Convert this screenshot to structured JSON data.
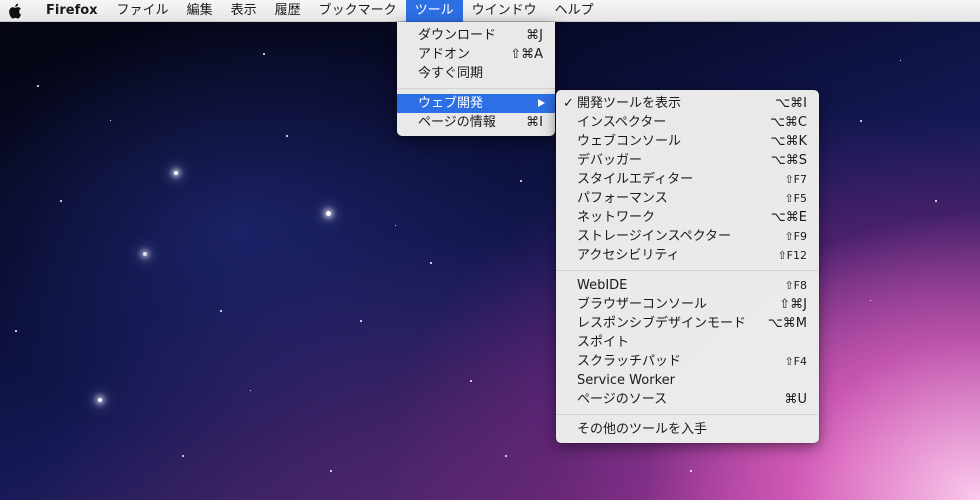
{
  "menubar": {
    "apple": "apple-logo-icon",
    "app_name": "Firefox",
    "items": [
      "ファイル",
      "編集",
      "表示",
      "履歴",
      "ブックマーク",
      "ツール",
      "ウインドウ",
      "ヘルプ"
    ],
    "active": "ツール"
  },
  "tools_menu": {
    "items": [
      {
        "label": "ダウンロード",
        "shortcut": "⌘J"
      },
      {
        "label": "アドオン",
        "shortcut": "⇧⌘A"
      },
      {
        "label": "今すぐ同期",
        "shortcut": ""
      },
      {
        "label": "ウェブ開発",
        "shortcut": "",
        "submenu": true,
        "highlighted": true
      },
      {
        "label": "ページの情報",
        "shortcut": "⌘I"
      }
    ]
  },
  "web_dev_submenu": {
    "checked_mark": "✓",
    "group1": [
      {
        "label": "開発ツールを表示",
        "shortcut": "⌥⌘I",
        "checked": true
      },
      {
        "label": "インスペクター",
        "shortcut": "⌥⌘C"
      },
      {
        "label": "ウェブコンソール",
        "shortcut": "⌥⌘K"
      },
      {
        "label": "デバッガー",
        "shortcut": "⌥⌘S"
      },
      {
        "label": "スタイルエディター",
        "shortcut": "⇧F7"
      },
      {
        "label": "パフォーマンス",
        "shortcut": "⇧F5"
      },
      {
        "label": "ネットワーク",
        "shortcut": "⌥⌘E"
      },
      {
        "label": "ストレージインスペクター",
        "shortcut": "⇧F9"
      },
      {
        "label": "アクセシビリティ",
        "shortcut": "⇧F12"
      }
    ],
    "group2": [
      {
        "label": "WebIDE",
        "shortcut": "⇧F8"
      },
      {
        "label": "ブラウザーコンソール",
        "shortcut": "⇧⌘J"
      },
      {
        "label": "レスポンシブデザインモード",
        "shortcut": "⌥⌘M"
      },
      {
        "label": "スポイト",
        "shortcut": ""
      },
      {
        "label": "スクラッチパッド",
        "shortcut": "⇧F4"
      },
      {
        "label": "Service Worker",
        "shortcut": ""
      },
      {
        "label": "ページのソース",
        "shortcut": "⌘U"
      }
    ],
    "group3": [
      {
        "label": "その他のツールを入手",
        "shortcut": ""
      }
    ]
  },
  "colors": {
    "highlight": "#2d6fe4",
    "menu_bg": "#eeeeee"
  }
}
